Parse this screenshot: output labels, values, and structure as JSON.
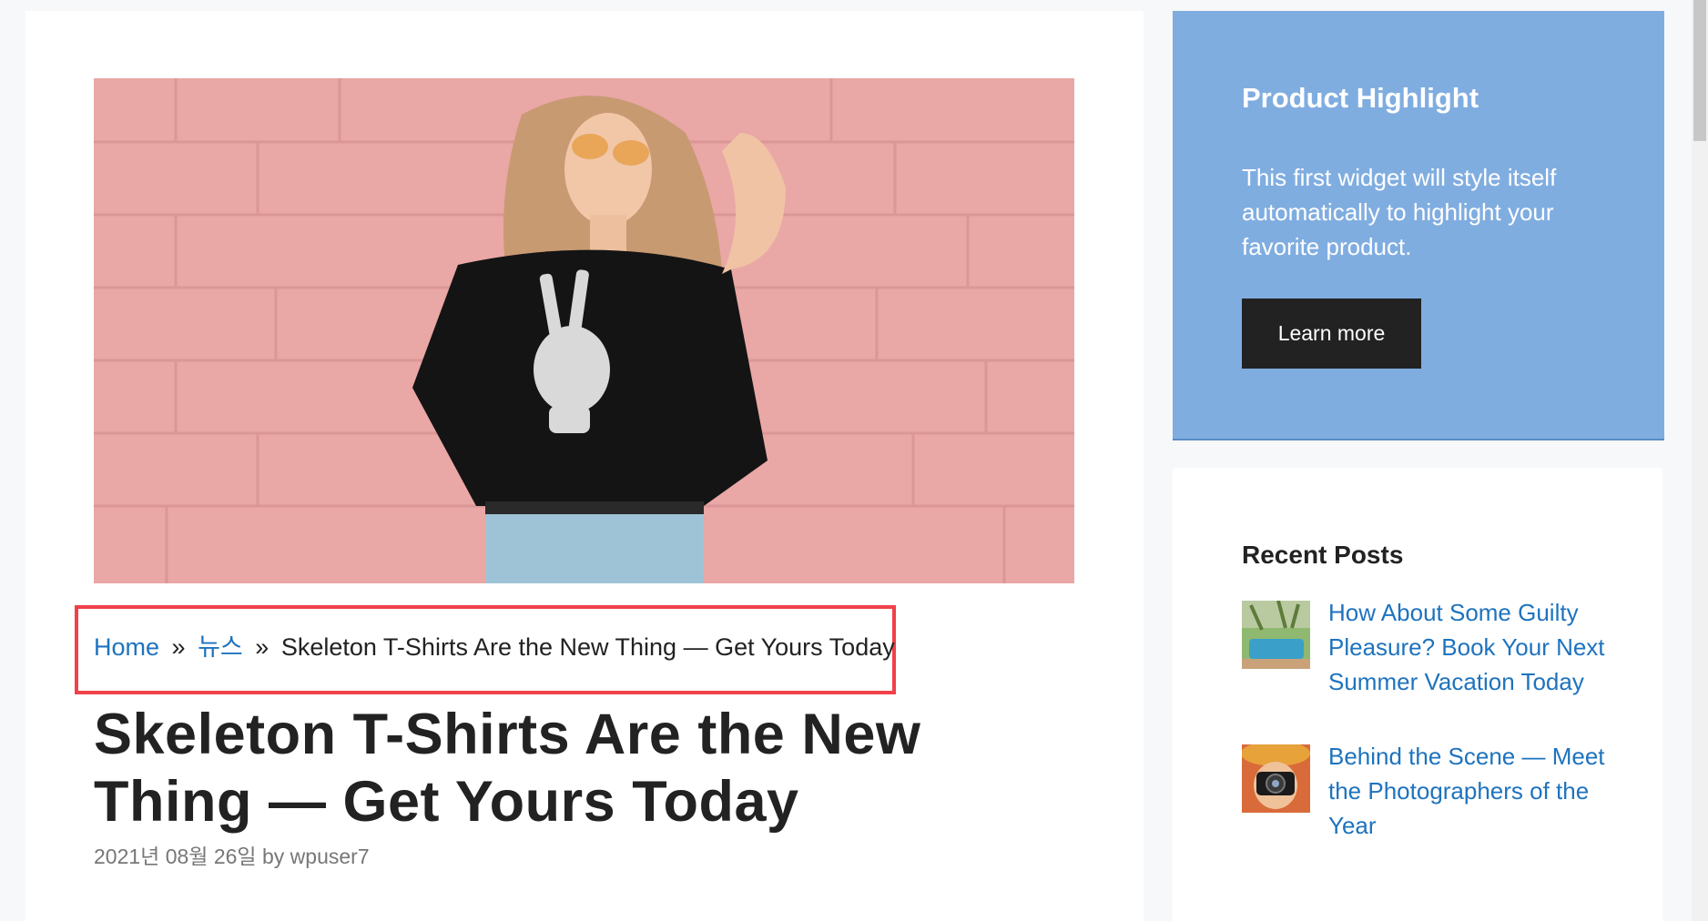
{
  "article": {
    "image_alt": "Woman wearing skeleton peace-sign t-shirt against pink brick wall",
    "breadcrumb": {
      "home": "Home",
      "separator": "»",
      "category": "뉴스",
      "current": "Skeleton T-Shirts Are the New Thing — Get Yours Today"
    },
    "title": "Skeleton T-Shirts Are the New Thing — Get Yours Today",
    "meta": {
      "date": "2021년 08월 26일",
      "by": "by",
      "author": "wpuser7"
    }
  },
  "sidebar": {
    "highlight": {
      "title": "Product Highlight",
      "text": "This first widget will style itself automatically to highlight your favorite product.",
      "button_label": "Learn more"
    },
    "recent": {
      "title": "Recent Posts",
      "posts": [
        {
          "label": "How About Some Guilty Pleasure? Book Your Next Summer Vacation Today",
          "thumb_icon": "pool-photo-icon"
        },
        {
          "label": "Behind the Scene — Meet the Photographers of the Year",
          "thumb_icon": "photographer-photo-icon"
        }
      ]
    }
  },
  "colors": {
    "link": "#1e73be",
    "highlight_bg": "#80ade0",
    "button_bg": "#222222",
    "annotation_border": "#f0414a"
  }
}
